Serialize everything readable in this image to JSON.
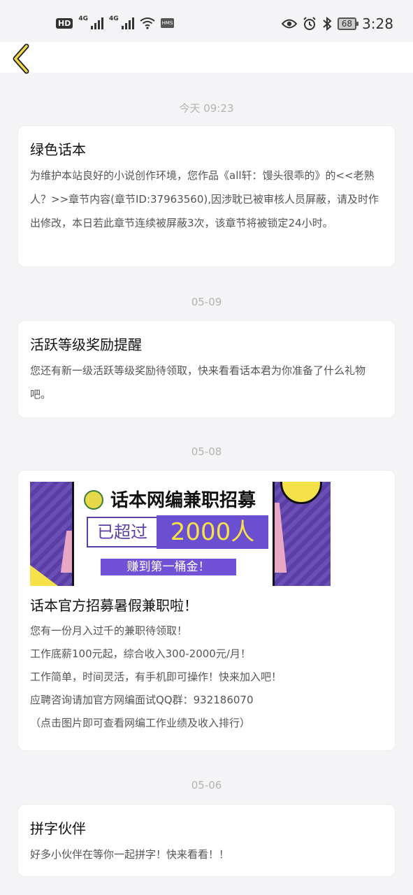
{
  "status_bar": {
    "hd_label": "HD",
    "sim1_label": "4G",
    "sim2_label": "4G",
    "hms_label": "HMS",
    "battery": "68",
    "time": "3:28"
  },
  "nav": {
    "back_icon": "chevron-left-icon"
  },
  "messages": [
    {
      "timestamp": "今天 09:23",
      "title": "绿色话本",
      "body": [
        "为维护本站良好的小说创作环境，您作品《all轩：馒头很乖的》的<<老熟人？>>章节内容(章节ID:37963560),因涉耽已被审核人员屏蔽，请及时作出修改，本日若此章节连续被屏蔽3次，该章节将被锁定24小时。"
      ]
    },
    {
      "timestamp": "05-09",
      "title": "活跃等级奖励提醒",
      "body": [
        "您还有新一级活跃等级奖励待领取，快来看看话本君为你准备了什么礼物吧。"
      ]
    },
    {
      "timestamp": "05-08",
      "banner": {
        "headline": "话本网编兼职招募",
        "exceeded": "已超过",
        "count": "2000人",
        "cta": "赚到第一桶金！"
      },
      "title": "话本官方招募暑假兼职啦！",
      "body": [
        "您有一份月入过千的兼职待领取！",
        "工作底薪100元起，综合收入300-2000元/月！",
        "工作简单，时间灵活，有手机即可操作！快来加入吧！",
        "应聘咨询请加官方网编面试QQ群：932186070",
        "（点击图片即可查看网编工作业绩及收入排行）"
      ]
    },
    {
      "timestamp": "05-06",
      "title": "拼字伙伴",
      "body": [
        "好多小伙伴在等你一起拼字！快来看看！！"
      ]
    }
  ],
  "colors": {
    "accent": "#f5e14a",
    "banner_purple": "#5b3fa8",
    "timestamp": "#b3b3b3"
  }
}
